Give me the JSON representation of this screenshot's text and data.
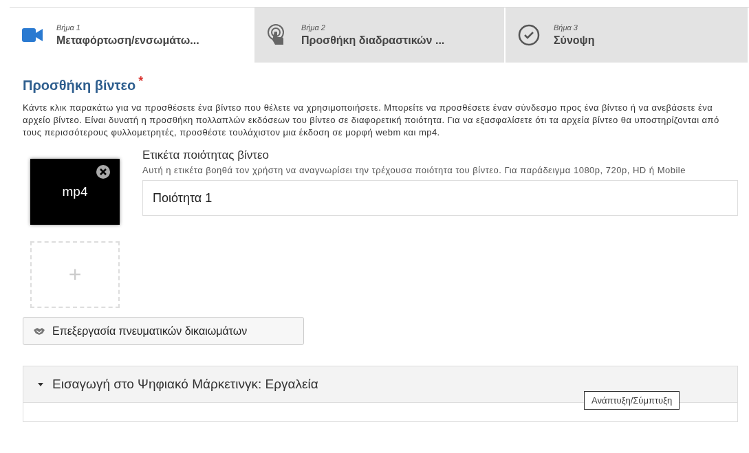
{
  "tabs": [
    {
      "step": "Βήμα 1",
      "label": "Μεταφόρτωση/ενσωμάτω...",
      "kind": "video",
      "selected": true
    },
    {
      "step": "Βήμα 2",
      "label": "Προσθήκη διαδραστικών ...",
      "kind": "touch",
      "selected": false
    },
    {
      "step": "Βήμα 3",
      "label": "Σύνοψη",
      "kind": "check",
      "selected": false
    }
  ],
  "section": {
    "title": "Προσθήκη βίντεο",
    "required_mark": "*",
    "description": "Κάντε κλικ παρακάτω για να προσθέσετε ένα βίντεο που θέλετε να χρησιμοποιήσετε. Μπορείτε να προσθέσετε έναν σύνδεσμο προς ένα βίντεο ή να ανεβάσετε ένα αρχείο βίντεο. Είναι δυνατή η προσθήκη πολλαπλών εκδόσεων του βίντεο σε διαφορετική ποιότητα. Για να εξασφαλίσετε ότι τα αρχεία βίντεο θα υποστηρίζονται από τους περισσότερους φυλλομετρητές, προσθέστε τουλάχιστον μια έκδοση σε μορφή webm και mp4."
  },
  "videos": [
    {
      "format": "mp4",
      "field_label": "Ετικέτα ποιότητας βίντεο",
      "field_help": "Αυτή η ετικέτα βοηθά τον χρήστη να αναγνωρίσει την τρέχουσα ποιότητα του βίντεο. Για παράδειγμα 1080p, 720p, HD ή Mobile",
      "value": "Ποιότητα 1"
    }
  ],
  "add_symbol": "+",
  "copyright_button": "Επεξεργασία πνευματικών δικαιωμάτων",
  "accordion": {
    "title": "Εισαγωγή στο Ψηφιακό Μάρκετινγκ: Εργαλεία",
    "expanded": true
  },
  "tooltip": "Ανάπτυξη/Σύμπτυξη"
}
